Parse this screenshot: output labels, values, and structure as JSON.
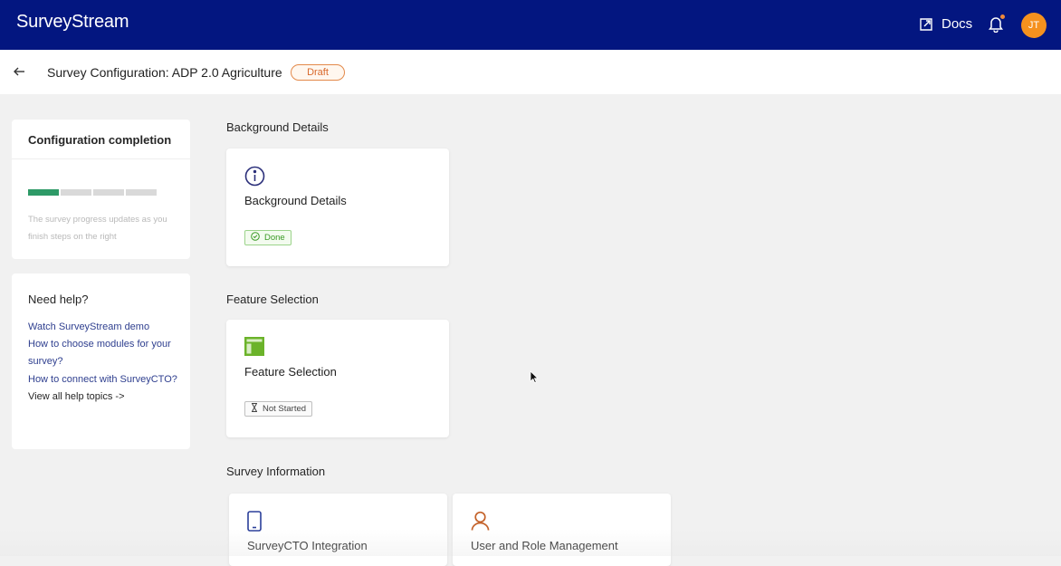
{
  "app": {
    "brand": "SurveyStream",
    "docs_label": "Docs",
    "avatar_initials": "JT",
    "brand_color": "#031680",
    "avatar_color": "#f5911e"
  },
  "page": {
    "title": "Survey Configuration: ADP 2.0 Agriculture",
    "status_badge": "Draft"
  },
  "completion": {
    "title": "Configuration completion",
    "progress": {
      "completed_segments": 1,
      "total_segments": 4
    },
    "note": "The survey progress updates as you finish steps on the right"
  },
  "help": {
    "title": "Need help?",
    "links": [
      "Watch SurveyStream demo",
      "How to choose modules for your survey?",
      "How to connect with SurveyCTO?",
      "View all help topics ->"
    ]
  },
  "sections": [
    {
      "title": "Background Details",
      "cards": [
        {
          "label": "Background Details",
          "icon": "info-icon",
          "status": "Done"
        }
      ]
    },
    {
      "title": "Feature Selection",
      "cards": [
        {
          "label": "Feature Selection",
          "icon": "layout-icon",
          "status": "Not Started"
        }
      ]
    },
    {
      "title": "Survey Information",
      "cards": [
        {
          "label": "SurveyCTO Integration",
          "icon": "mobile-icon"
        },
        {
          "label": "User and Role Management",
          "icon": "user-icon"
        }
      ]
    }
  ]
}
